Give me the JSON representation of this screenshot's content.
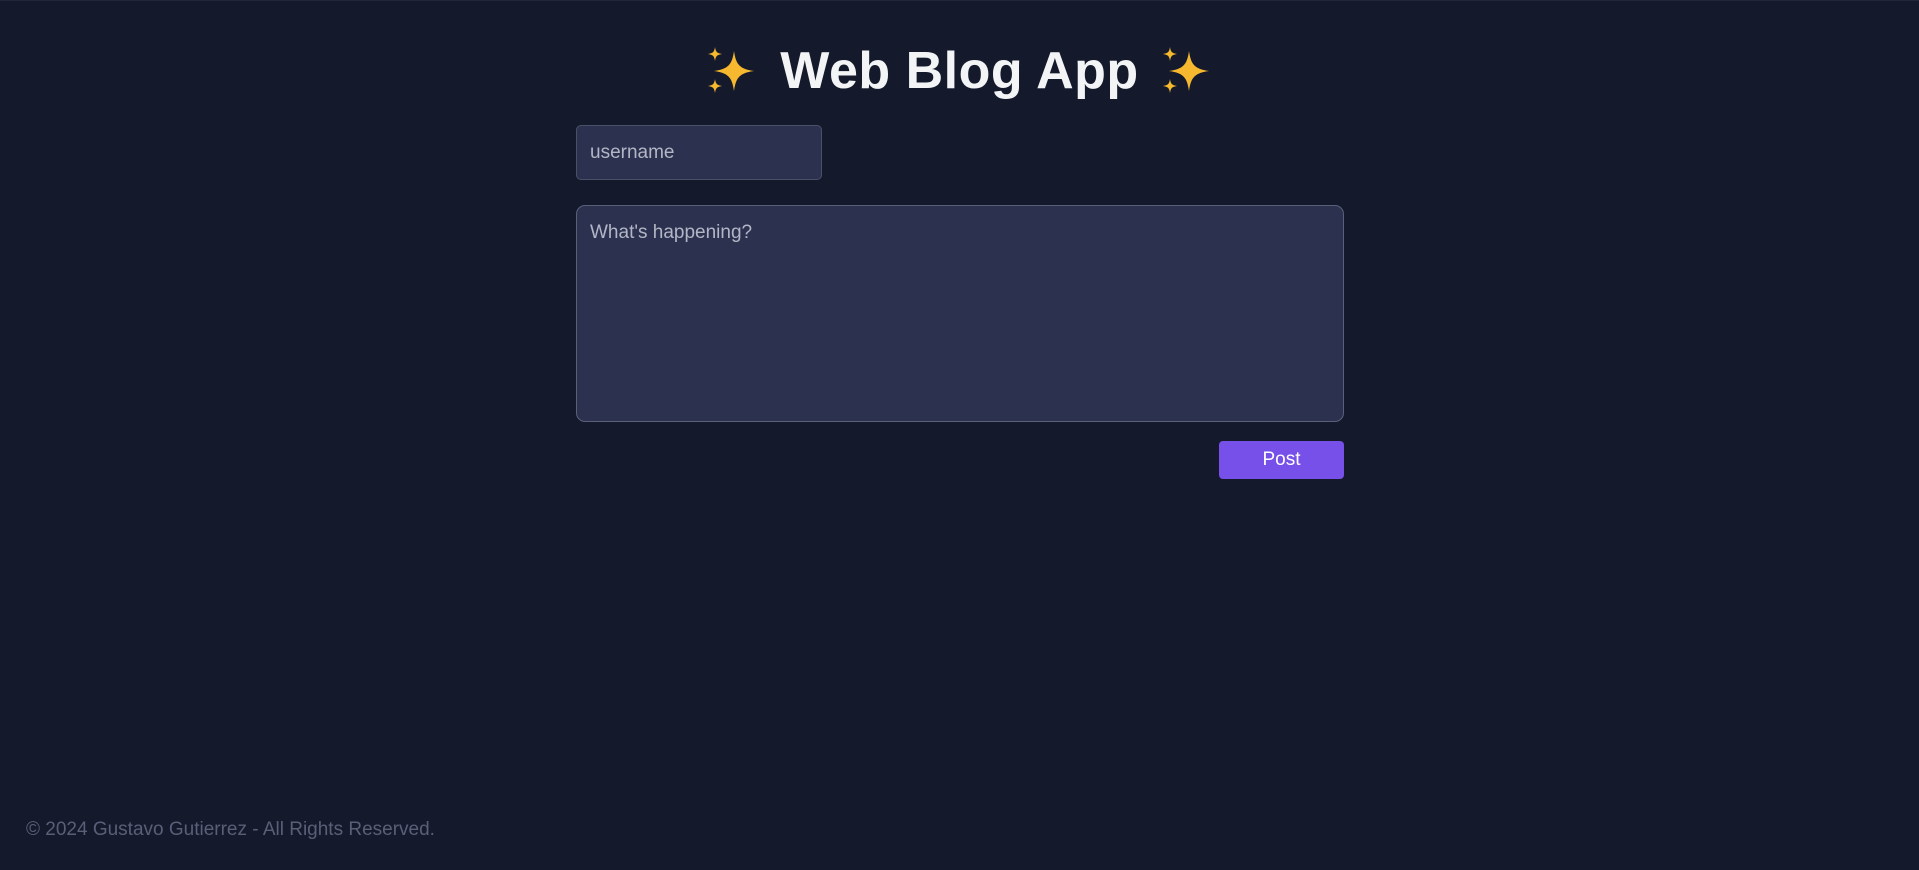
{
  "header": {
    "title": "Web Blog App",
    "left_icon": "sparkles-icon",
    "right_icon": "sparkles-icon",
    "icon_color": "#f5b82e"
  },
  "form": {
    "username_placeholder": "username",
    "username_value": "",
    "post_placeholder": "What's happening?",
    "post_value": "",
    "post_button_label": "Post"
  },
  "footer": {
    "text": "© 2024 Gustavo Gutierrez - All Rights Reserved."
  },
  "colors": {
    "background": "#141a2c",
    "input_background": "#2d3150",
    "accent": "#7650e8",
    "footer_text": "#5a5f78"
  }
}
